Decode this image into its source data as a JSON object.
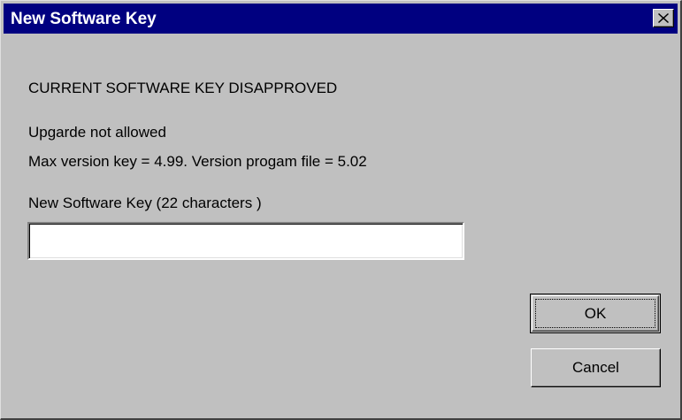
{
  "window": {
    "title": "New Software Key",
    "title_bar_color": "#000080",
    "close_icon": "close-icon"
  },
  "messages": {
    "status": "CURRENT SOFTWARE KEY DISAPPROVED",
    "detail_line1": "Upgarde not allowed",
    "detail_line2": "Max version key = 4.99. Version progam file = 5.02"
  },
  "key_field": {
    "label": "New Software Key (22 characters )",
    "value": "",
    "placeholder": ""
  },
  "buttons": {
    "ok_label": "OK",
    "cancel_label": "Cancel"
  }
}
